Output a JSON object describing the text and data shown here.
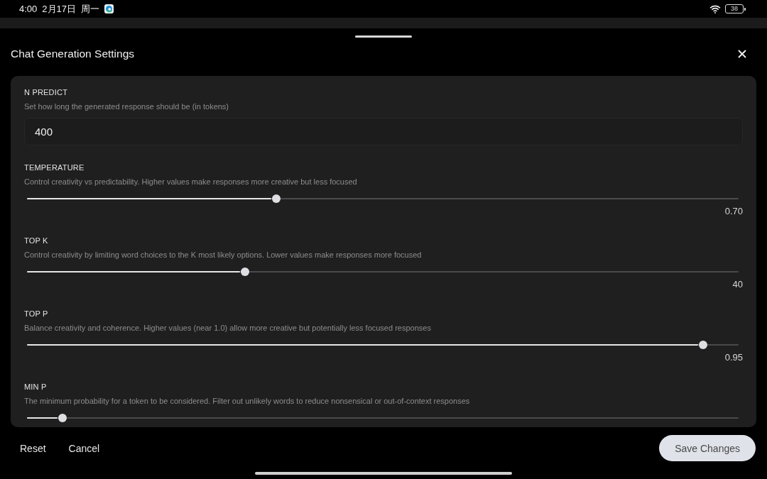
{
  "status_bar": {
    "time": "4:00",
    "date": "2月17日",
    "weekday": "周一",
    "battery": "38"
  },
  "sheet": {
    "title": "Chat Generation Settings"
  },
  "settings": [
    {
      "kind": "number",
      "label": "N PREDICT",
      "description": "Set how long the generated response should be (in tokens)",
      "value": "400"
    },
    {
      "kind": "slider",
      "label": "TEMPERATURE",
      "description": "Control creativity vs predictability. Higher values make responses more creative but less focused",
      "level": 0.35,
      "reading": "0.70"
    },
    {
      "kind": "slider",
      "label": "TOP K",
      "description": "Control creativity by limiting word choices to the K most likely options. Lower values make responses more focused",
      "level": 0.306,
      "reading": "40"
    },
    {
      "kind": "slider",
      "label": "TOP P",
      "description": "Balance creativity and coherence. Higher values (near 1.0) allow more creative but potentially less focused responses",
      "level": 0.95,
      "reading": "0.95"
    },
    {
      "kind": "slider",
      "label": "MIN P",
      "description": "The minimum probability for a token to be considered. Filter out unlikely words to reduce nonsensical or out-of-context responses",
      "level": 0.05
    }
  ],
  "footer": {
    "buttons": [
      {
        "kind": "text",
        "label": "Reset"
      },
      {
        "kind": "text",
        "label": "Cancel"
      },
      {
        "kind": "primary",
        "label": "Save Changes"
      }
    ]
  }
}
